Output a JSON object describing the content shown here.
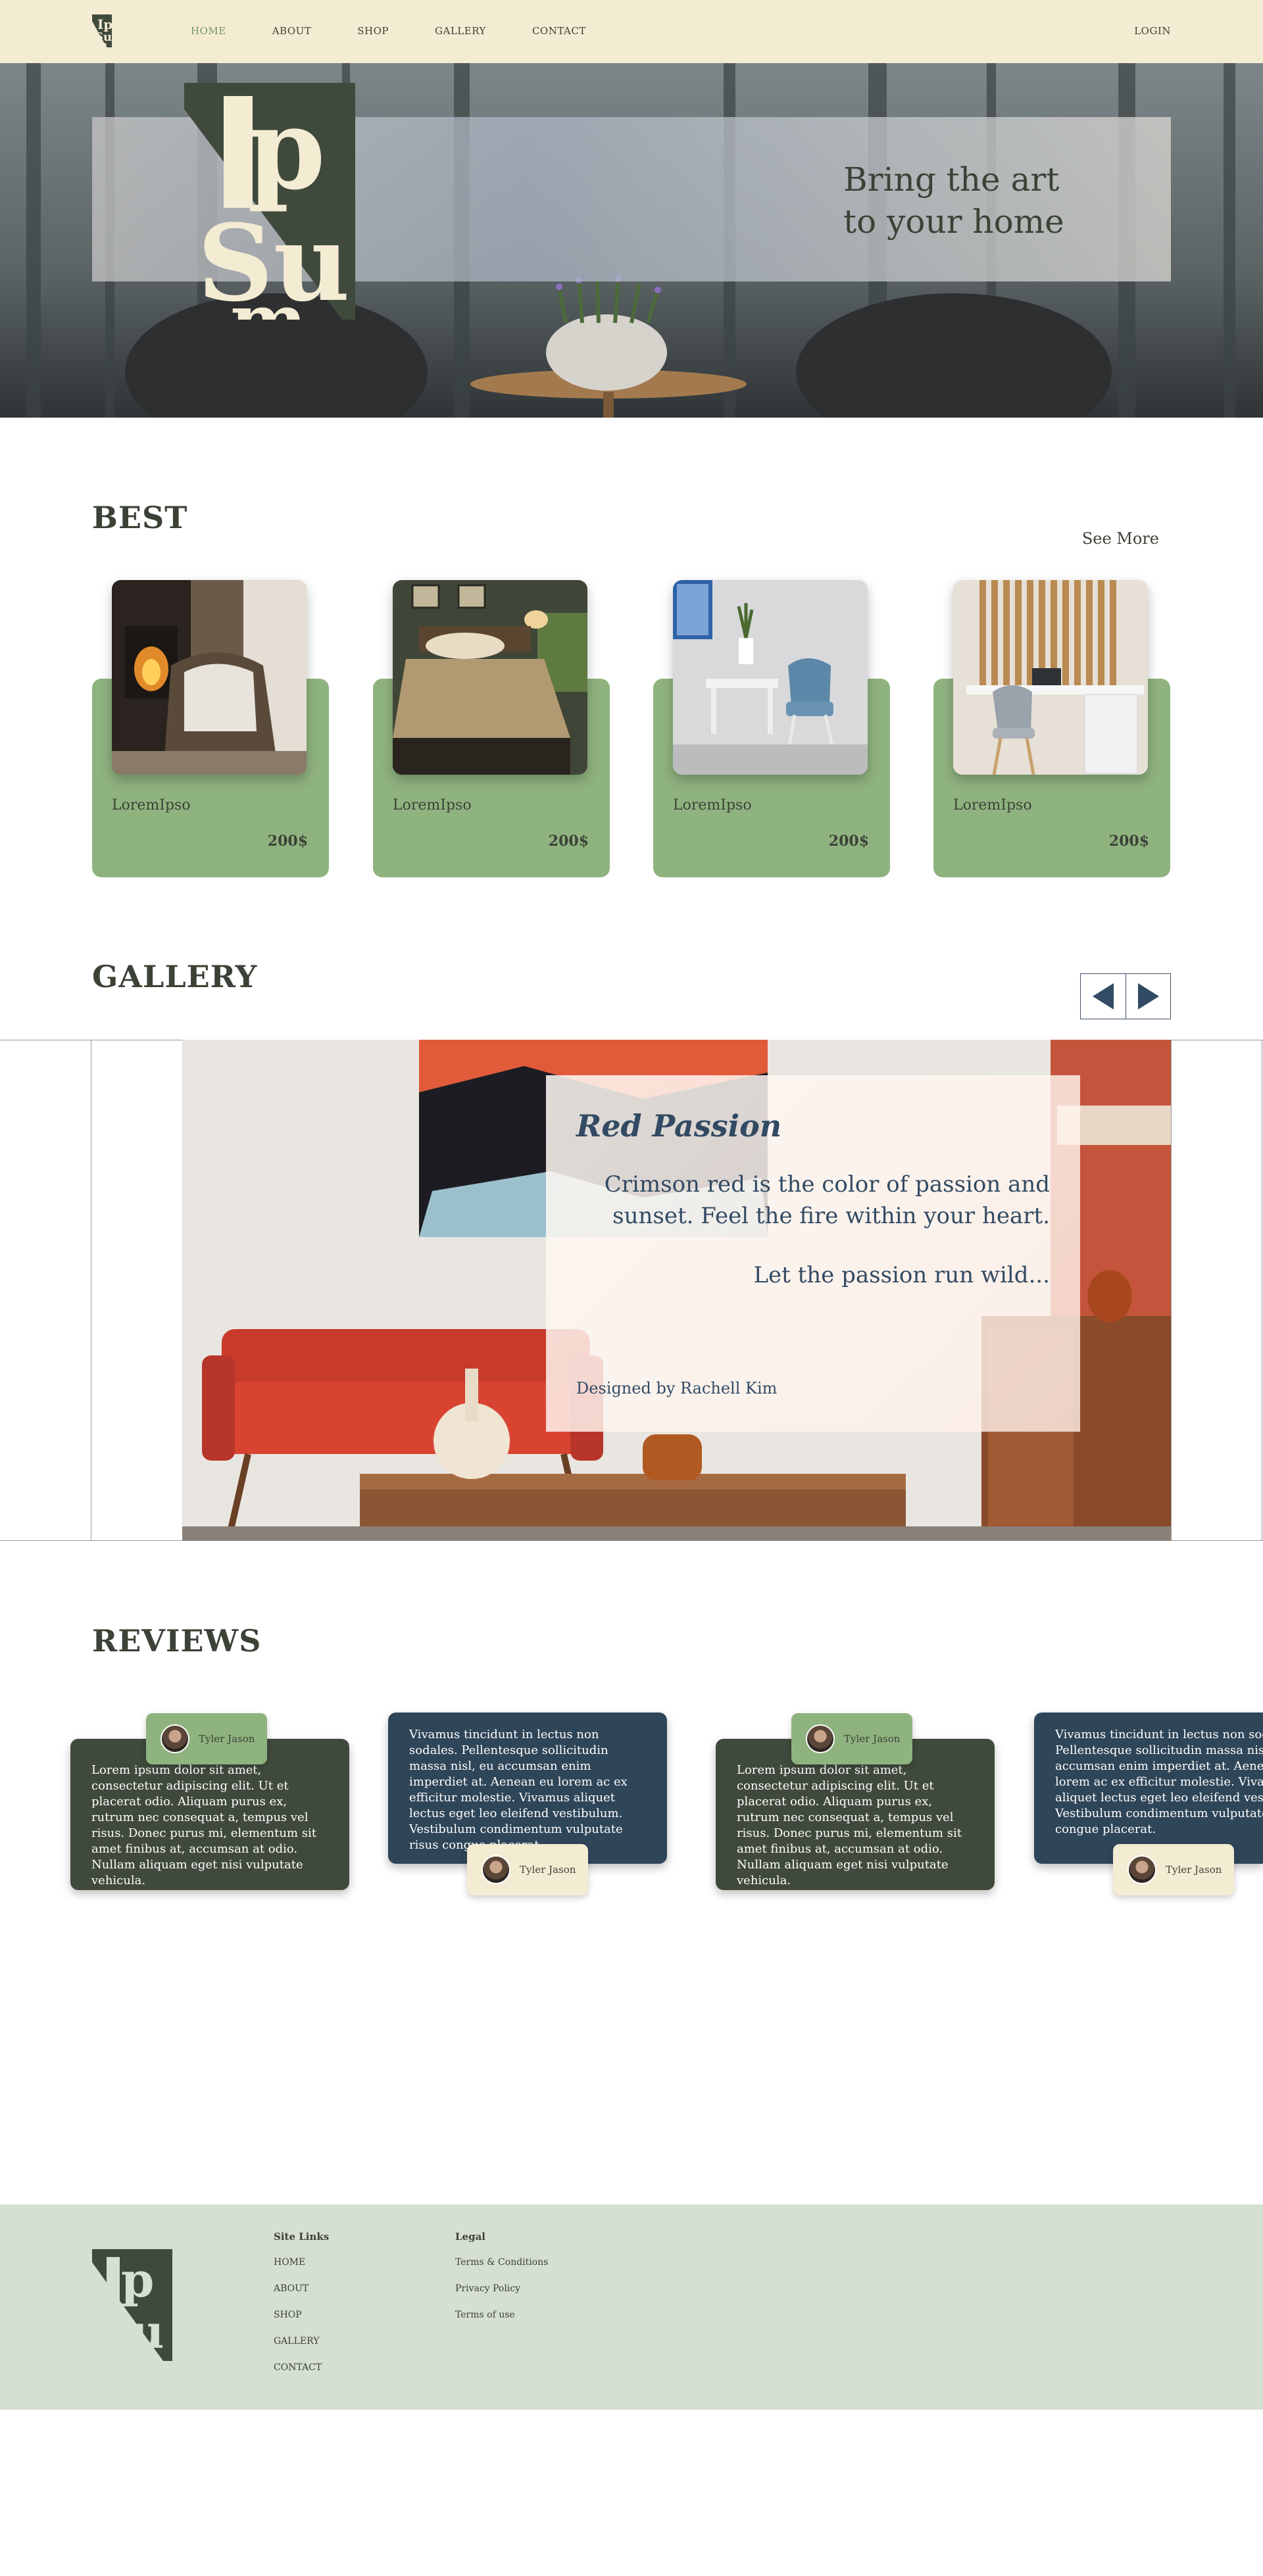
{
  "colors": {
    "nav_bg": "#f4ebd3",
    "accent_green": "#8fb37f",
    "active_link": "#6f9a5f",
    "dark_green": "#3f4a3c",
    "navy": "#2f4558",
    "footer_bg": "#d5dfd2",
    "text": "#3b4236"
  },
  "nav": {
    "logo_icon": "ipsum-logo-icon",
    "links": [
      "HOME",
      "ABOUT",
      "SHOP",
      "GALLERY",
      "CONTACT"
    ],
    "active": "HOME",
    "login": "LOGIN"
  },
  "hero": {
    "tagline_line1": "Bring the art",
    "tagline_line2": "to your home",
    "logo_letters": "Ipsum"
  },
  "best": {
    "title": "BEST",
    "see_more": "See More",
    "items": [
      {
        "name": "LoremIpso",
        "price": "200$"
      },
      {
        "name": "LoremIpso",
        "price": "200$"
      },
      {
        "name": "LoremIpso",
        "price": "200$"
      },
      {
        "name": "LoremIpso",
        "price": "200$"
      }
    ]
  },
  "gallery": {
    "title": "GALLERY",
    "prev_icon": "triangle-left-icon",
    "next_icon": "triangle-right-icon",
    "slide": {
      "title": "Red Passion",
      "text": "Crimson red is the color of passion and sunset. Feel the fire within your heart.",
      "text2": "Let the passion run wild...",
      "credit": "Designed by Rachell Kim"
    }
  },
  "reviews": {
    "title": "REVIEWS",
    "items": [
      {
        "author": "Tyler Jason",
        "text": "Lorem ipsum dolor sit amet, consectetur adipiscing elit. Ut et placerat odio. Aliquam purus ex, rutrum nec consequat a, tempus vel risus. Donec purus mi, elementum sit amet finibus at, accumsan at odio. Nullam aliquam eget nisi vulputate vehicula."
      },
      {
        "author": "Tyler Jason",
        "text": "Vivamus tincidunt in lectus non sodales. Pellentesque sollicitudin massa nisl, eu accumsan enim imperdiet at. Aenean eu lorem ac ex efficitur molestie. Vivamus aliquet lectus eget leo eleifend vestibulum. Vestibulum condimentum vulputate risus congue placerat."
      },
      {
        "author": "Tyler Jason",
        "text": "Lorem ipsum dolor sit amet, consectetur adipiscing elit. Ut et placerat odio. Aliquam purus ex, rutrum nec consequat a, tempus vel risus. Donec purus mi, elementum sit amet finibus at, accumsan at odio. Nullam aliquam eget nisi vulputate vehicula."
      },
      {
        "author": "Tyler Jason",
        "text": "Vivamus tincidunt in lectus non sodales. Pellentesque sollicitudin massa nisl, eu accumsan enim imperdiet at. Aenean eu lorem ac ex efficitur molestie. Vivamus aliquet lectus eget leo eleifend vestibulum. Vestibulum condimentum vulputate risus congue placerat."
      }
    ]
  },
  "footer": {
    "site_links_title": "Site Links",
    "site_links": [
      "HOME",
      "ABOUT",
      "SHOP",
      "GALLERY",
      "CONTACT"
    ],
    "legal_title": "Legal",
    "legal_links": [
      "Terms & Conditions",
      "Privacy Policy",
      "Terms of use"
    ]
  }
}
